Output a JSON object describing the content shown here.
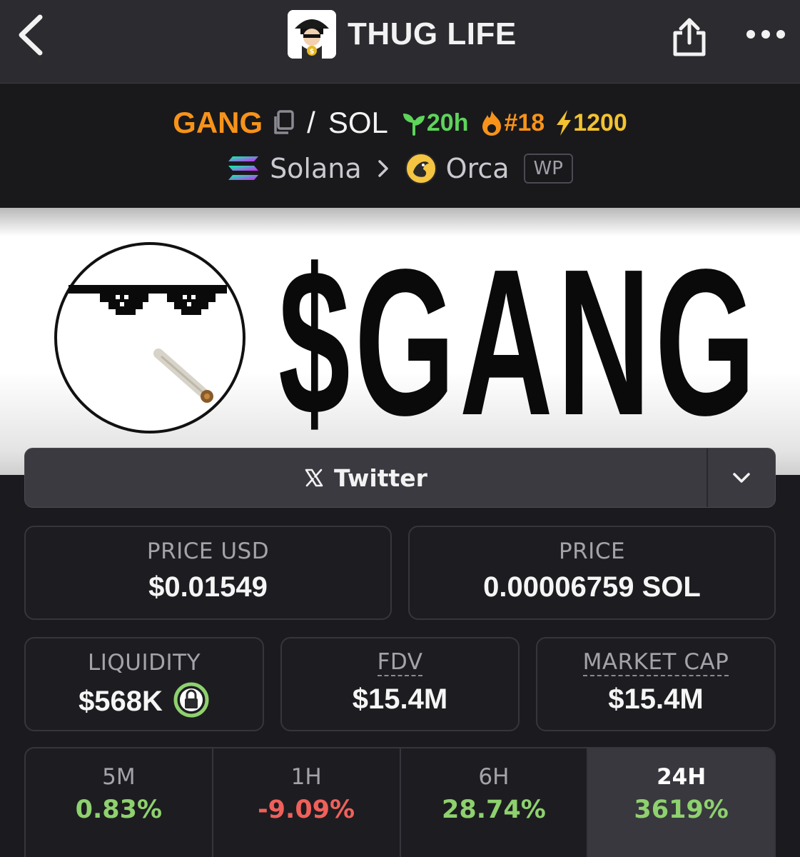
{
  "nav": {
    "title": "THUG LIFE"
  },
  "pair": {
    "base_token": "GANG",
    "slash": "/",
    "quote_token": "SOL",
    "age": "20h",
    "rank": "#18",
    "boosts": "1200",
    "chain": "Solana",
    "dex": "Orca",
    "wp_label": "WP"
  },
  "banner": {
    "text": "$GANG"
  },
  "social": {
    "twitter_label": "Twitter"
  },
  "stats": {
    "price_usd_label": "PRICE USD",
    "price_usd_value": "$0.01549",
    "price_label": "PRICE",
    "price_value": "0.00006759 SOL",
    "liquidity_label": "LIQUIDITY",
    "liquidity_value": "$568K",
    "fdv_label": "FDV",
    "fdv_value": "$15.4M",
    "mcap_label": "MARKET CAP",
    "mcap_value": "$15.4M"
  },
  "changes": [
    {
      "label": "5M",
      "value": "0.83%",
      "direction": "up"
    },
    {
      "label": "1H",
      "value": "-9.09%",
      "direction": "down"
    },
    {
      "label": "6H",
      "value": "28.74%",
      "direction": "up"
    },
    {
      "label": "24H",
      "value": "3619%",
      "direction": "up",
      "active": true
    }
  ],
  "colors": {
    "base_token": "#f7931a",
    "age": "#5ed45a",
    "rank": "#f7931a",
    "boost": "#f2c230",
    "positive": "#8ed16e",
    "negative": "#f0605a"
  }
}
